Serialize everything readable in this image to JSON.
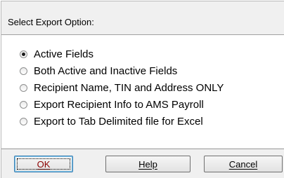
{
  "dialog": {
    "header_title": "Select Export Option:"
  },
  "options": [
    {
      "label": "Active Fields",
      "checked": true
    },
    {
      "label": "Both Active and Inactive Fields",
      "checked": false
    },
    {
      "label": "Recipient Name, TIN and Address ONLY",
      "checked": false
    },
    {
      "label": "Export Recipient Info to AMS Payroll",
      "checked": false
    },
    {
      "label": "Export to Tab Delimited file for Excel",
      "checked": false
    }
  ],
  "buttons": {
    "ok_label": "OK",
    "help_label": "Help",
    "cancel_label": "Cancel"
  }
}
